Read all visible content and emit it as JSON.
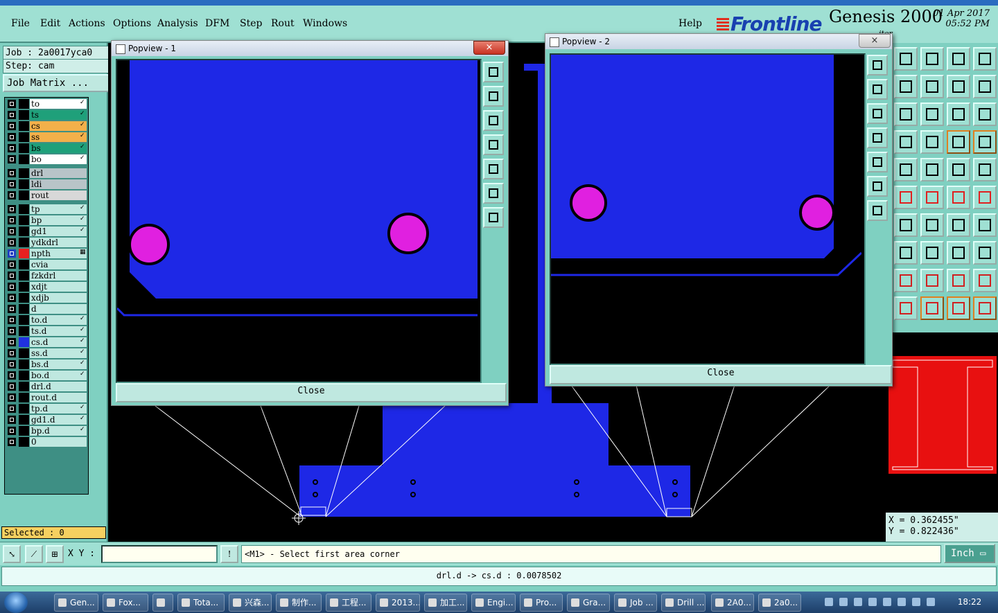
{
  "menu": {
    "items": [
      "File",
      "Edit",
      "Actions",
      "Options",
      "Analysis",
      "DFM",
      "Step",
      "Rout",
      "Windows"
    ],
    "help": "Help"
  },
  "branding": {
    "logo": "Frontline",
    "product": "Genesis 2000",
    "date": "01 Apr 2017",
    "time": "05:52 PM",
    "editor_fragment": "itor"
  },
  "job": {
    "job_line": "Job : 2a0017yca0",
    "step_line": "Step: cam",
    "matrix_button": "Job Matrix ..."
  },
  "layers": [
    {
      "name": "to",
      "bg": "#ffffff",
      "flag": "✓"
    },
    {
      "name": "ts",
      "bg": "#1fa07a",
      "flag": "✓"
    },
    {
      "name": "cs",
      "bg": "#f3b04a",
      "flag": "✓"
    },
    {
      "name": "ss",
      "bg": "#f3b04a",
      "flag": "✓"
    },
    {
      "name": "bs",
      "bg": "#1fa07a",
      "flag": "✓"
    },
    {
      "name": "bo",
      "bg": "#ffffff",
      "flag": "✓"
    },
    {
      "name": "drl",
      "bg": "#b8c4c8",
      "flag": ""
    },
    {
      "name": "ldi",
      "bg": "#b8c4c8",
      "flag": ""
    },
    {
      "name": "rout",
      "bg": "#d8d8d8",
      "flag": ""
    },
    {
      "name": "tp",
      "bg": "#bfe8e0",
      "flag": "✓"
    },
    {
      "name": "bp",
      "bg": "#bfe8e0",
      "flag": "✓"
    },
    {
      "name": "gd1",
      "bg": "#bfe8e0",
      "flag": "✓"
    },
    {
      "name": "ydkdrl",
      "bg": "#bfe8e0",
      "flag": ""
    },
    {
      "name": "npth",
      "bg": "#bfe8e0",
      "flag": "▦",
      "color": "#e82020",
      "active": true
    },
    {
      "name": "cvia",
      "bg": "#bfe8e0",
      "flag": ""
    },
    {
      "name": "fzkdrl",
      "bg": "#bfe8e0",
      "flag": ""
    },
    {
      "name": "xdjt",
      "bg": "#bfe8e0",
      "flag": ""
    },
    {
      "name": "xdjb",
      "bg": "#bfe8e0",
      "flag": ""
    },
    {
      "name": "d",
      "bg": "#bfe8e0",
      "flag": ""
    },
    {
      "name": "to.d",
      "bg": "#bfe8e0",
      "flag": "✓"
    },
    {
      "name": "ts.d",
      "bg": "#bfe8e0",
      "flag": "✓"
    },
    {
      "name": "cs.d",
      "bg": "#bfe8e0",
      "flag": "✓",
      "color": "#2030e0"
    },
    {
      "name": "ss.d",
      "bg": "#bfe8e0",
      "flag": "✓"
    },
    {
      "name": "bs.d",
      "bg": "#bfe8e0",
      "flag": "✓"
    },
    {
      "name": "bo.d",
      "bg": "#bfe8e0",
      "flag": "✓"
    },
    {
      "name": "drl.d",
      "bg": "#bfe8e0",
      "flag": ""
    },
    {
      "name": "rout.d",
      "bg": "#bfe8e0",
      "flag": ""
    },
    {
      "name": "tp.d",
      "bg": "#bfe8e0",
      "flag": "✓"
    },
    {
      "name": "gd1.d",
      "bg": "#bfe8e0",
      "flag": "✓"
    },
    {
      "name": "bp.d",
      "bg": "#bfe8e0",
      "flag": "✓"
    },
    {
      "name": "0",
      "bg": "#bfe8e0",
      "flag": ""
    }
  ],
  "selected": "Selected : 0",
  "popview1": {
    "title": "Popview - 1",
    "close": "Close",
    "x": "×"
  },
  "popview2": {
    "title": "Popview - 2",
    "close": "Close",
    "x": "×"
  },
  "coords": {
    "x": "X = 0.362455\"",
    "y": "Y = 0.822436\""
  },
  "command": {
    "xy_label": "X Y :",
    "xy_value": "",
    "prompt": "<M1> - Select first area corner",
    "unit": "Inch"
  },
  "status": "drl.d -> cs.d : 0.0078502",
  "taskbar": {
    "tasks": [
      "Gen...",
      "Fox...",
      "",
      "Tota...",
      "兴森...",
      "制作...",
      "工程...",
      "2013...",
      "加工...",
      "Engi...",
      "Pro...",
      "Gra...",
      "Job ...",
      "Drill ...",
      "2A0...",
      "2a0..."
    ],
    "clock": "18:22"
  },
  "colors": {
    "copper": "#1e28e6",
    "pad": "#e020e0",
    "panel": "#7fd0c1",
    "npth": "#e82020"
  },
  "right_tools": [
    "measure-icon",
    "layer-icon",
    "home-icon",
    "window-icon",
    "left-icon",
    "right-icon",
    "undo-icon",
    "snap-icon",
    "center-icon",
    "zoom-icon",
    "scale-icon",
    "help-icon",
    "settings-icon",
    "grid-icon",
    "connect-icon",
    "connect2-icon",
    "pad-icon",
    "color-icon",
    "ruler-icon",
    "dot-icon",
    "node-icon",
    "cross-icon",
    "line-icon",
    "line2-icon",
    "angle-icon",
    "slash-icon",
    "arc-icon",
    "split-icon",
    "move-icon",
    "minus-icon",
    "fit-icon",
    "group-icon",
    "shape-icon",
    "shape2-icon",
    "shape3-icon",
    "shape4-icon",
    "pointer-icon",
    "pointer2-icon",
    "pointer3-icon",
    "pointer4-icon"
  ]
}
